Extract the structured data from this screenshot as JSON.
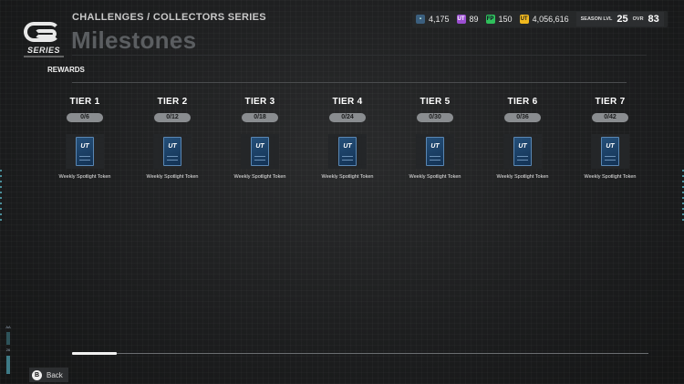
{
  "header": {
    "breadcrumb": "CHALLENGES / COLLECTORS SERIES",
    "title": "Milestones",
    "logo_text": "SERIES"
  },
  "hud": {
    "coins": "4,175",
    "coins_icon": "ticket-icon",
    "pp": "89",
    "pp_icon": "ut-pp-icon",
    "fp": "150",
    "fp_icon": "fp-icon",
    "ut_coins": "4,056,616",
    "ut_icon": "ut-coin-icon",
    "season_label": "SEASON LVL",
    "season_level": "25",
    "ovr_label": "OVR",
    "ovr": "83"
  },
  "rewards_label": "REWARDS",
  "tiers": [
    {
      "name": "TIER 1",
      "progress": "0/6",
      "reward": "Weekly Spotlight Token"
    },
    {
      "name": "TIER 2",
      "progress": "0/12",
      "reward": "Weekly Spotlight Token"
    },
    {
      "name": "TIER 3",
      "progress": "0/18",
      "reward": "Weekly Spotlight Token"
    },
    {
      "name": "TIER 4",
      "progress": "0/24",
      "reward": "Weekly Spotlight Token"
    },
    {
      "name": "TIER 5",
      "progress": "0/30",
      "reward": "Weekly Spotlight Token"
    },
    {
      "name": "TIER 6",
      "progress": "0/36",
      "reward": "Weekly Spotlight Token"
    },
    {
      "name": "TIER 7",
      "progress": "0/42",
      "reward": "Weekly Spotlight Token"
    }
  ],
  "card_text": "UT",
  "footer": {
    "back_button_glyph": "B",
    "back_label": "Back"
  },
  "side": {
    "top": "AA",
    "value": "26"
  },
  "colors": {
    "accent": "#3d7a86",
    "progress_pill": "#8a8d90",
    "card_blue": "#1c4166"
  }
}
